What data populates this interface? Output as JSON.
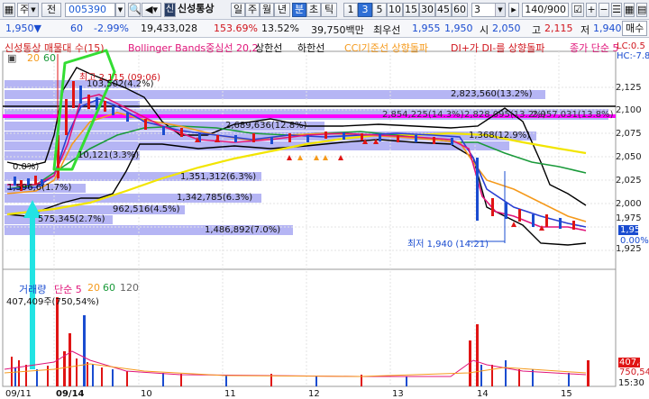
{
  "toolbar": {
    "market_combo": "주",
    "history_btn": "전",
    "stock_code": "005390",
    "sound_icon": "speaker-icon",
    "stock_badge": "신",
    "stock_name": "신성통상",
    "periods": [
      "일",
      "주",
      "월",
      "년",
      "분",
      "초",
      "틱"
    ],
    "period_active": "분",
    "intervals": [
      "1",
      "3",
      "5",
      "10",
      "15",
      "30",
      "45",
      "60"
    ],
    "interval_active": "3",
    "interval_select": "3",
    "count": "140/900"
  },
  "quote": {
    "price": "1,950▼",
    "change": "60",
    "change_pct": "-2.99%",
    "volume": "19,433,028",
    "vol_ratio": "153.69%",
    "turnover": "13.52%",
    "amount": "39,750백만",
    "best_label": "최우선",
    "best_ask": "1,955",
    "best_bid": "1,950",
    "open_label": "시",
    "open": "2,050",
    "high_label": "고",
    "high": "2,115",
    "low_label": "저",
    "low": "1,940",
    "buy_label": "매수"
  },
  "legend": {
    "item1": "신성통상 매물대 수(15)",
    "item2": "Bollinger Bands중심선 20,2",
    "item3": "상한선",
    "item4": "하한선",
    "item5": "CCI기준선 상향돌파",
    "item6": "DI+가 DI-를 상향돌파",
    "item7": "종가 단순 5",
    "sub1": "20",
    "sub2": "60"
  },
  "volume_legend": {
    "item1": "거래량",
    "item2": "단순 5",
    "item3": "20",
    "item4": "60",
    "item5": "120",
    "value": "407,409주(750,54%)"
  },
  "annotations": {
    "high_tag": "최고 2,115 (09:06)",
    "low_tag": "최저 1,940 (14:21)",
    "top_left_pct": "0.0%)",
    "top_right_lc": "LC:0.5",
    "top_right_hc": "HC:-7.8",
    "price_right": "1,950",
    "pct_right": "0.00%",
    "vol_right": "407,40",
    "vol_right2": "750,54"
  },
  "volume_profile": [
    {
      "label": "2,823,560(13.2%)"
    },
    {
      "label": "2,854,225(14.3%)"
    },
    {
      "label": "2,828,095(13.2%)"
    },
    {
      "label": "2,957,031(13.8%)"
    },
    {
      "label": "103,502(4.2%)"
    },
    {
      "label": "1,368(12.9%)"
    },
    {
      "label": "2,689,636(12.8%)"
    },
    {
      "label": "10,121(3.3%)"
    },
    {
      "label": "1,351,312(6.3%)"
    },
    {
      "label": "1,342,785(6.3%)"
    },
    {
      "label": "962,516(4.5%)"
    },
    {
      "label": "575,345(2.7%)"
    },
    {
      "label": "1,486,892(7.0%)"
    },
    {
      "label": "1,596,6(1.7%)"
    }
  ],
  "y_axis": [
    "2,125",
    "2,100",
    "2,075",
    "2,050",
    "2,025",
    "2,000",
    "1,975",
    "1,950",
    "1,925"
  ],
  "x_axis": [
    "09/11",
    "09/14",
    "10",
    "11",
    "12",
    "13",
    "14",
    "15",
    "15:30"
  ]
}
